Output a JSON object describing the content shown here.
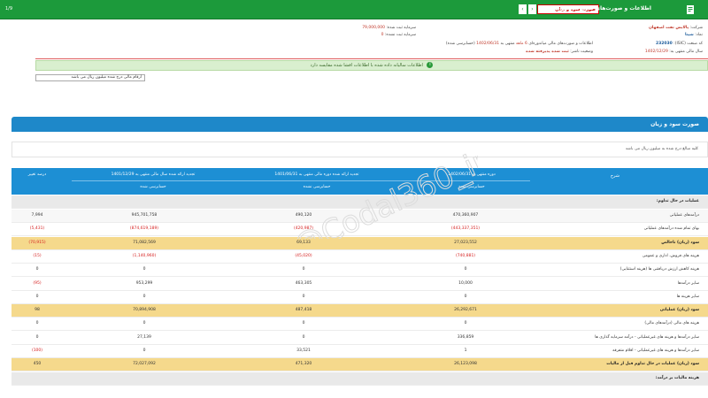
{
  "topbar": {
    "title": "اطلاعات و صورت‌های مالی میاندوره‌ای",
    "report_select": "صورت سود و زیان",
    "prev_arrow": "‹",
    "next_arrow": "›",
    "page_indicator": "1/9",
    "bg_color": "#1c9a3b"
  },
  "info": {
    "company_label": "شرکت:",
    "company_value": "پالایش نفت اصفهان",
    "symbol_label": "نماد:",
    "symbol_value": "شپنا",
    "isic_label": "کد صنعت (ISIC):",
    "isic_value": "232030",
    "fiscal_label": "سال مالی منتهی به:",
    "fiscal_value": "1402/12/29",
    "capital_label": "سرمایه ثبت شده:",
    "capital_value": "79,000,000",
    "unregistered_label": "سرمایه ثبت نشده:",
    "unregistered_value": "0",
    "period_text": "اطلاعات و صورت‌های مالی میاندوره‌ای",
    "months_value": "6 ماهه",
    "ending_label": "منتهی به",
    "ending_value": "1402/06/31",
    "audit_status": "(حسابرسی شده)",
    "publish_label": "وضعیت ناشر:",
    "publish_value": "ثبت شده پذیرفته شده"
  },
  "green_notice": "اطلاعات سالیانه داده شده با اطلاعات افشا شده مقایسه دارد",
  "unit_box": "ارقام مالی درج شده میلیون ریال می باشد",
  "section": {
    "title": "صورت سود و زیان",
    "note": "کلیه مبالغ درج شده به میلیون ریال می باشد"
  },
  "table": {
    "col_desc": "شرح",
    "col1_top": "دوره منتهی به 1402/06/31",
    "col1_sub": "حسابرسی شده",
    "col2_top": "تجدید ارائه شده دوره مالی منتهی به 1401/06/31",
    "col2_sub": "حسابرسی نشده",
    "col3_top": "تجدید ارائه شده سال مالی منتهی به 1401/12/29",
    "col3_sub": "حسابرسی شده",
    "col4_top": "درصد تغییر",
    "section_label": "عملیات در حال تداوم:",
    "rows": [
      {
        "label": "درآمدهای عملیاتی",
        "v1": "470,360,907",
        "v2": "490,120",
        "v3": "945,701,758",
        "v4": "7,994",
        "style": "grey"
      },
      {
        "label": "بهای تمام شده درآمدهای عملیاتی",
        "v1": "(443,337,351)",
        "v2": "(420,987)",
        "v3": "(874,619,189)",
        "v4": "(5,431)",
        "style": "plain",
        "neg": true
      },
      {
        "label": "سود (زیان) ناخالص",
        "v1": "27,023,552",
        "v2": "69,133",
        "v3": "71,082,569",
        "v4": "(70,915)",
        "style": "hl",
        "neg4": true
      },
      {
        "label": "هزینه های فروش، اداری و عمومی",
        "v1": "(740,881)",
        "v2": "(45,020)",
        "v3": "(1,140,960)",
        "v4": "(15)",
        "style": "plain",
        "neg": true
      },
      {
        "label": "هزینه کاهش ارزش دریافتنی ها (هزینه استثنایی)",
        "v1": "0",
        "v2": "0",
        "v3": "0",
        "v4": "0",
        "style": "plain"
      },
      {
        "label": "سایر درآمدها",
        "v1": "10,000",
        "v2": "463,305",
        "v3": "953,299",
        "v4": "(95)",
        "style": "plain",
        "neg4": true
      },
      {
        "label": "سایر هزینه ها",
        "v1": "0",
        "v2": "0",
        "v3": "0",
        "v4": "0",
        "style": "plain"
      },
      {
        "label": "سود (زیان) عملیاتی",
        "v1": "26,292,671",
        "v2": "487,418",
        "v3": "70,894,908",
        "v4": "98",
        "style": "hl"
      },
      {
        "label": "هزینه های مالی (درآمدهای مالی)",
        "v1": "0",
        "v2": "0",
        "v3": "0",
        "v4": "0",
        "style": "plain"
      },
      {
        "label": "سایر درآمدها و هزینه های غیرعملیاتی - درآمد سرمایه گذاری ها",
        "v1": "336,859",
        "v2": "0",
        "v3": "27,139",
        "v4": "0",
        "style": "plain"
      },
      {
        "label": "سایر درآمدها و هزینه های غیرعملیاتی - اقلام متفرقه",
        "v1": "1",
        "v2": "33,521",
        "v3": "0",
        "v4": "(100)",
        "style": "plain",
        "neg4": true
      },
      {
        "label": "سود (زیان) عملیات در حال تداوم قبل از مالیات",
        "v1": "26,123,098",
        "v2": "471,320",
        "v3": "72,027,092",
        "v4": "450",
        "style": "hl"
      },
      {
        "label": "هزینه مالیات بر درآمد:",
        "v1": "",
        "v2": "",
        "v3": "",
        "v4": "",
        "style": "sub"
      }
    ]
  }
}
